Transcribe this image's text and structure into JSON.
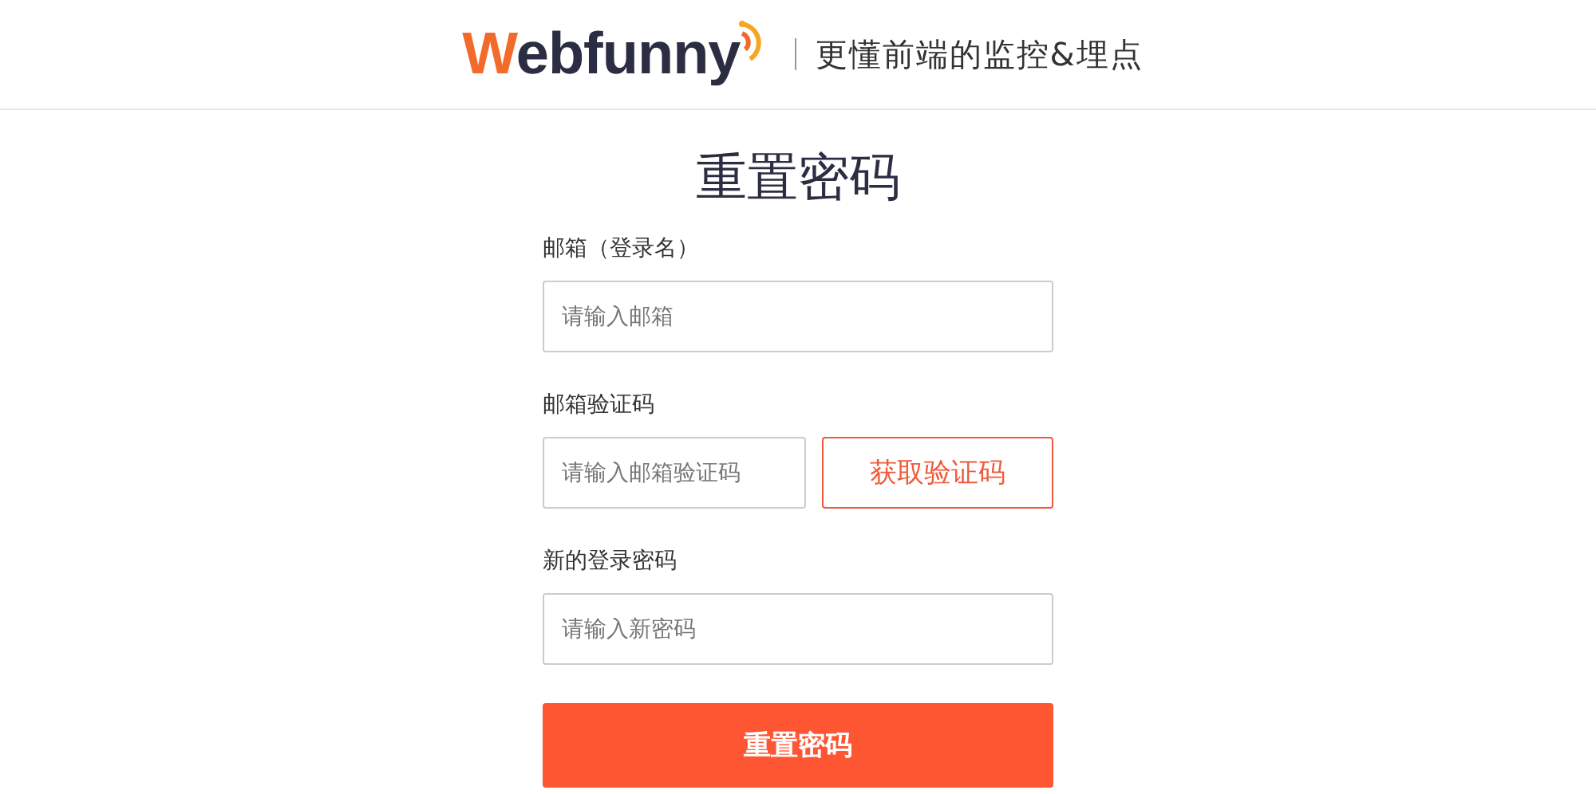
{
  "header": {
    "logo": "Webfunny",
    "slogan": "更懂前端的监控&埋点"
  },
  "title": "重置密码",
  "fields": [
    {
      "label": "邮箱（登录名）",
      "placeholder": "请输入邮箱",
      "kind": "input"
    },
    {
      "label": "邮箱验证码",
      "placeholder": "请输入邮箱验证码",
      "kind": "code",
      "button": "获取验证码"
    },
    {
      "label": "新的登录密码",
      "placeholder": "请输入新密码",
      "kind": "input"
    }
  ],
  "submit": "重置密码"
}
